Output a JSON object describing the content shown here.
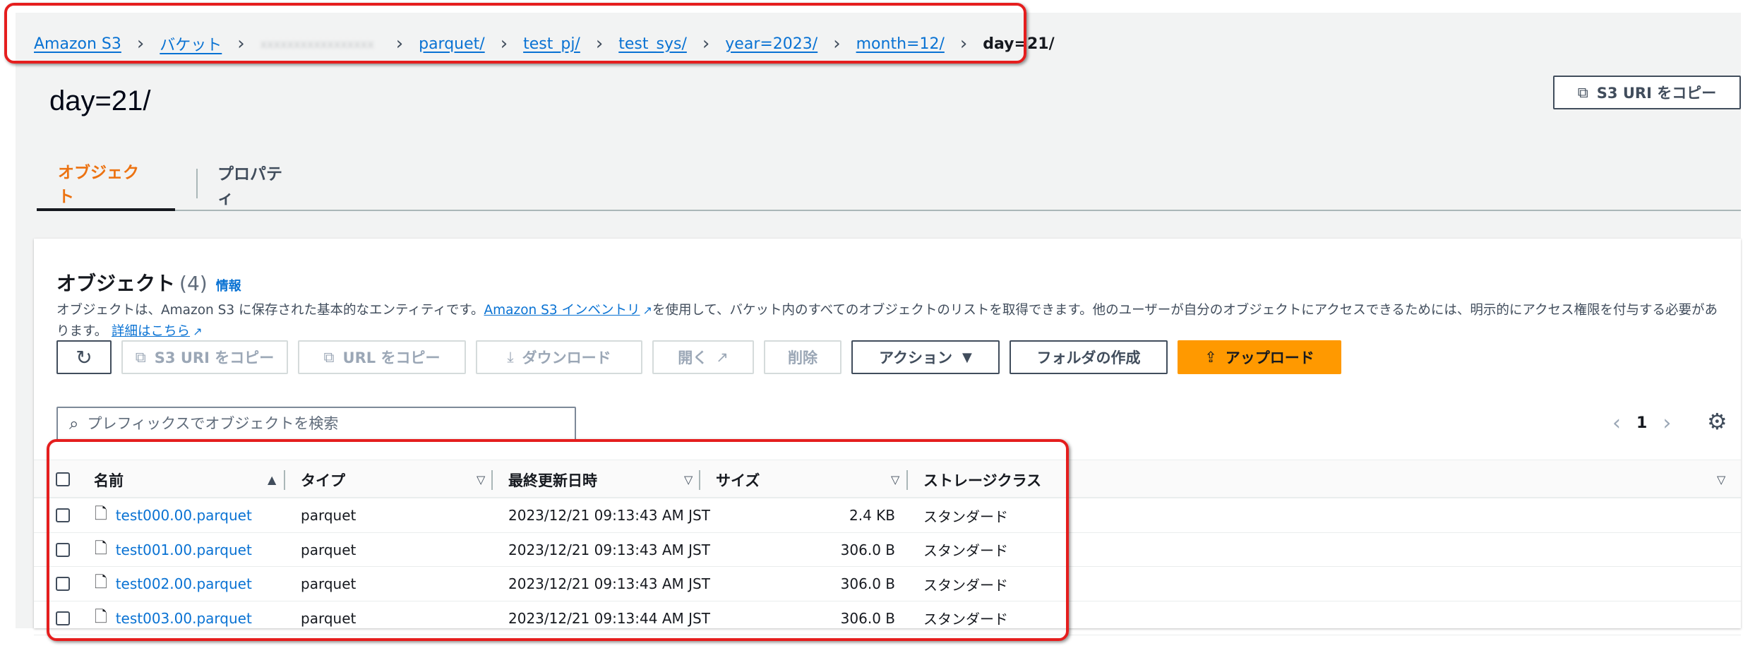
{
  "breadcrumb": {
    "items": [
      "Amazon S3",
      "バケット",
      "bucket-name-hidden",
      "parquet/",
      "test_pj/",
      "test_sys/",
      "year=2023/",
      "month=12/"
    ],
    "current": "day=21/"
  },
  "header": {
    "title": "day=21/",
    "copy_uri_label": "S3 URI をコピー"
  },
  "tabs": [
    {
      "label": "オブジェクト",
      "active": true
    },
    {
      "label": "プロパティ",
      "active": false
    }
  ],
  "objects_panel": {
    "title": "オブジェクト",
    "count": "(4)",
    "info_link": "情報",
    "description_1": "オブジェクトは、Amazon S3 に保存された基本的なエンティティです。",
    "description_link": "Amazon S3 インベントリ",
    "description_2": "を使用して、バケット内のすべてのオブジェクトのリストを取得できます。他のユーザーが自分のオブジェクトにアクセスできるためには、明示的にアクセス権限を付与する必要があります。",
    "details_link": "詳細はこちら"
  },
  "toolbar": {
    "refresh_icon": "refresh-icon",
    "copy_s3_uri": "S3 URI をコピー",
    "copy_url": "URL をコピー",
    "download": "ダウンロード",
    "open": "開く",
    "delete": "削除",
    "actions": "アクション",
    "create_folder": "フォルダの作成",
    "upload": "アップロード"
  },
  "search": {
    "placeholder": "プレフィックスでオブジェクトを検索"
  },
  "pagination": {
    "page": "1"
  },
  "table": {
    "columns": [
      "名前",
      "タイプ",
      "最終更新日時",
      "サイズ",
      "ストレージクラス"
    ],
    "rows": [
      {
        "name": "test000.00.parquet",
        "type": "parquet",
        "modified": "2023/12/21 09:13:43 AM JST",
        "size": "2.4 KB",
        "storage": "スタンダード"
      },
      {
        "name": "test001.00.parquet",
        "type": "parquet",
        "modified": "2023/12/21 09:13:43 AM JST",
        "size": "306.0 B",
        "storage": "スタンダード"
      },
      {
        "name": "test002.00.parquet",
        "type": "parquet",
        "modified": "2023/12/21 09:13:43 AM JST",
        "size": "306.0 B",
        "storage": "スタンダード"
      },
      {
        "name": "test003.00.parquet",
        "type": "parquet",
        "modified": "2023/12/21 09:13:44 AM JST",
        "size": "306.0 B",
        "storage": "スタンダード"
      }
    ]
  },
  "colors": {
    "link": "#0972d3",
    "accent_tab": "#ec7211",
    "primary_button": "#ff9900",
    "highlight": "#e51e1e"
  }
}
